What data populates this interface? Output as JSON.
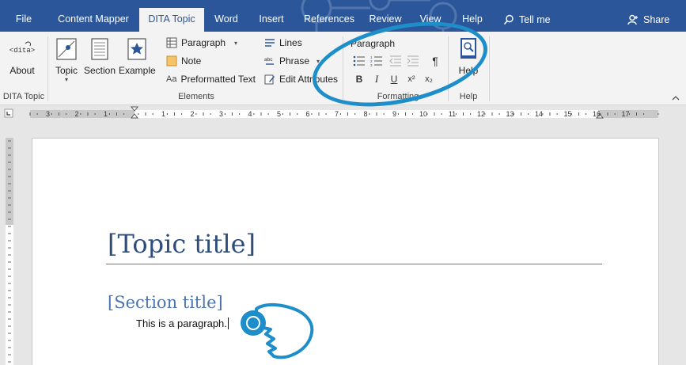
{
  "tabs": [
    {
      "label": "File"
    },
    {
      "label": "Content Mapper"
    },
    {
      "label": "DITA Topic"
    },
    {
      "label": "Word"
    },
    {
      "label": "Insert"
    },
    {
      "label": "References"
    },
    {
      "label": "Review"
    },
    {
      "label": "View"
    },
    {
      "label": "Help"
    }
  ],
  "tell_me": "Tell me",
  "share": "Share",
  "ribbon": {
    "dita_topic": {
      "label": "DITA Topic",
      "about": "About"
    },
    "elements": {
      "label": "Elements",
      "topic": "Topic",
      "section": "Section",
      "example": "Example",
      "paragraph": "Paragraph",
      "note": "Note",
      "preformatted": "Preformatted Text",
      "lines": "Lines",
      "phrase": "Phrase",
      "edit_attributes": "Edit Attributes"
    },
    "formatting": {
      "label": "Formatting",
      "paragraph_heading": "Paragraph",
      "bold": "B",
      "italic": "I",
      "underline": "U",
      "superscript": "x²",
      "subscript": "x₂",
      "pilcrow": "¶"
    },
    "help": {
      "label": "Help",
      "help_button": "Help"
    }
  },
  "ruler_numbers": [
    "3",
    "2",
    "1",
    "1",
    "2",
    "3",
    "4",
    "5",
    "6",
    "7",
    "8",
    "9",
    "10",
    "11",
    "12",
    "13",
    "14",
    "15",
    "16",
    "17"
  ],
  "document": {
    "topic_title": "[Topic title]",
    "section_title": "[Section title]",
    "paragraph": "This is a paragraph."
  },
  "colors": {
    "ribbon_blue": "#2b579a",
    "callout_blue": "#1d8ec9",
    "title_blue": "#2e4d7b"
  }
}
